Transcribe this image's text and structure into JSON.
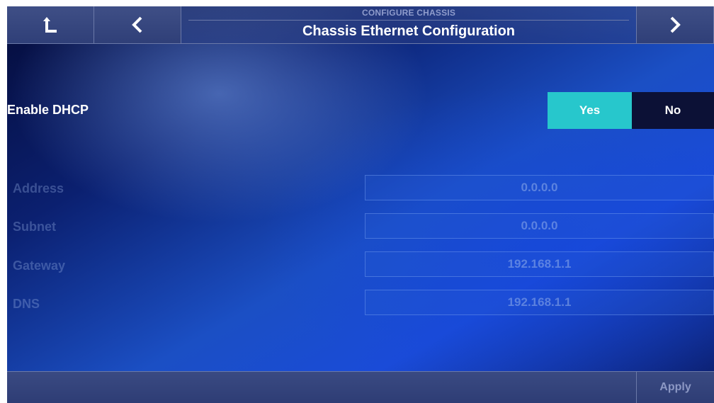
{
  "header": {
    "subtitle": "CONFIGURE CHASSIS",
    "title": "Chassis Ethernet Configuration"
  },
  "nav": {
    "up_icon": "up-return-arrow-icon",
    "back_icon": "chevron-left-icon",
    "next_icon": "chevron-right-icon"
  },
  "dhcp": {
    "label": "Enable DHCP",
    "yes_label": "Yes",
    "no_label": "No",
    "selected": "Yes"
  },
  "fields": [
    {
      "label": "Address",
      "value": "0.0.0.0"
    },
    {
      "label": "Subnet",
      "value": "0.0.0.0"
    },
    {
      "label": "Gateway",
      "value": "192.168.1.1"
    },
    {
      "label": "DNS",
      "value": "192.168.1.1"
    }
  ],
  "footer": {
    "apply_label": "Apply"
  },
  "colors": {
    "accent": "#27c7cc",
    "dark_button": "#0c1136",
    "bar": "#34447c"
  }
}
